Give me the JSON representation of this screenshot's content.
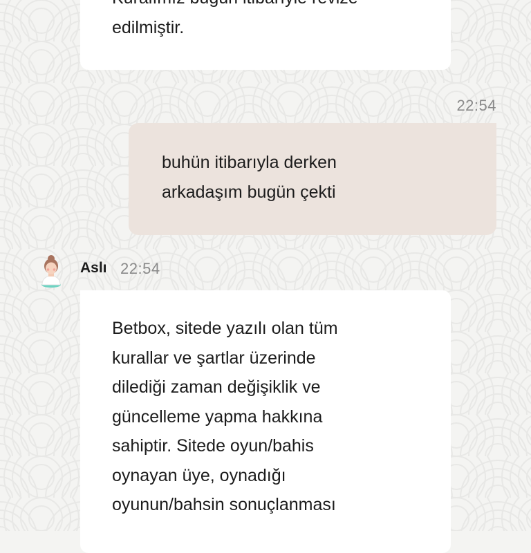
{
  "messages": {
    "previous_agent": {
      "lines": [
        "Kuralımız bugün itibarıyle revize",
        "edilmiştir."
      ]
    },
    "user": {
      "time": "22:54",
      "lines": [
        "buhün itibarıyla derken",
        "arkadaşım bugün çekti"
      ]
    },
    "agent": {
      "name": "Aslı",
      "time": "22:54",
      "avatar": "agent-avatar-icon",
      "lines": [
        "Betbox, sitede yazılı olan tüm",
        "kurallar ve şartlar üzerinde",
        "dilediği zaman değişiklik ve",
        "güncelleme yapma hakkına",
        "sahiptir. Sitede oyun/bahis",
        "oynayan üye, oynadığı",
        "oyunun/bahsin sonuçlanması"
      ]
    }
  },
  "colors": {
    "background": "#f4f4f2",
    "agent_bubble": "#ffffff",
    "user_bubble": "#ece3dd",
    "timestamp": "#8a8a8a"
  }
}
